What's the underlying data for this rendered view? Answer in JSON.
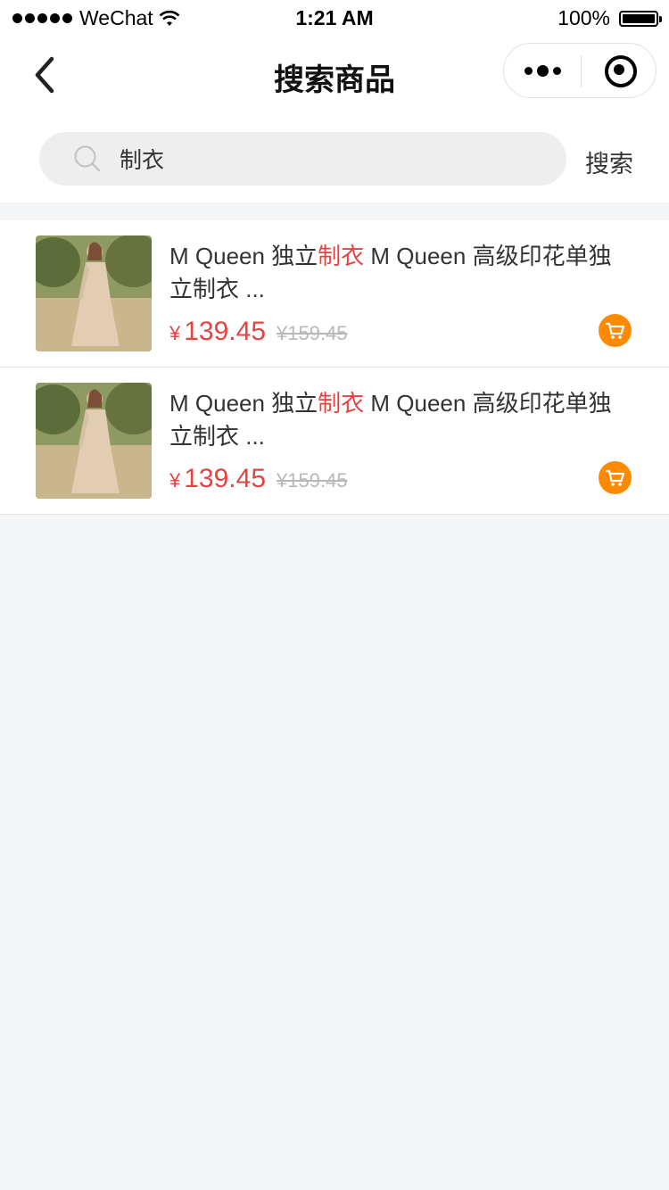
{
  "status_bar": {
    "carrier": "WeChat",
    "time": "1:21 AM",
    "battery_percent": "100%"
  },
  "nav": {
    "title": "搜索商品"
  },
  "search": {
    "query": "制衣",
    "button_label": "搜索"
  },
  "results": [
    {
      "title_before": "M Queen 独立",
      "title_highlight": "制衣",
      "title_after": " M Queen 高级印花单独立制衣 ...",
      "currency": "¥",
      "price": "139.45",
      "original_price": "¥159.45"
    },
    {
      "title_before": "M Queen 独立",
      "title_highlight": "制衣",
      "title_after": " M Queen 高级印花单独立制衣 ...",
      "currency": "¥",
      "price": "139.45",
      "original_price": "¥159.45"
    }
  ],
  "colors": {
    "accent": "#e64340",
    "cart": "#ff8a00",
    "background": "#f4f5f7"
  },
  "icons": [
    "back-arrow-icon",
    "more-icon",
    "mini-program-close-icon",
    "search-icon",
    "cart-icon",
    "wifi-icon",
    "battery-icon"
  ]
}
